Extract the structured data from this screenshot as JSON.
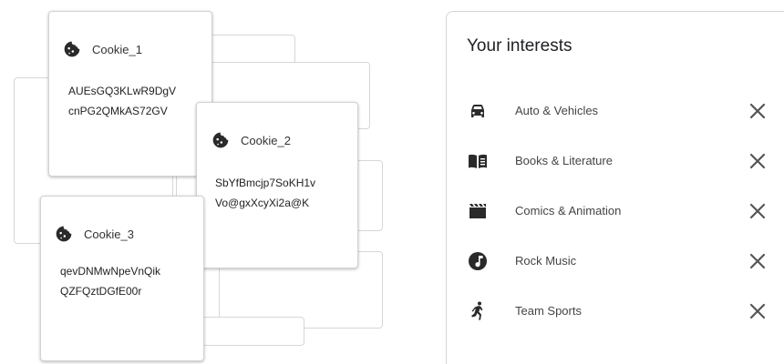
{
  "cookies": [
    {
      "title": "Cookie_1",
      "line1": "AUEsGQ3KLwR9DgV",
      "line2": "cnPG2QMkAS72GV"
    },
    {
      "title": "Cookie_2",
      "line1": "SbYfBmcjp7SoKH1v",
      "line2": "Vo@gxXcyXi2a@K"
    },
    {
      "title": "Cookie_3",
      "line1": "qevDNMwNpeVnQik",
      "line2": "QZFQztDGfE00r"
    }
  ],
  "interests_panel": {
    "title": "Your interests",
    "items": [
      {
        "label": "Auto & Vehicles",
        "icon": "car-icon"
      },
      {
        "label": "Books & Literature",
        "icon": "book-icon"
      },
      {
        "label": "Comics & Animation",
        "icon": "clapperboard-icon"
      },
      {
        "label": "Rock Music",
        "icon": "music-note-icon"
      },
      {
        "label": "Team Sports",
        "icon": "sports-icon"
      }
    ]
  },
  "colors": {
    "icon": "#2a2a2a",
    "remove": "#555555",
    "border": "#d4d4d4"
  }
}
